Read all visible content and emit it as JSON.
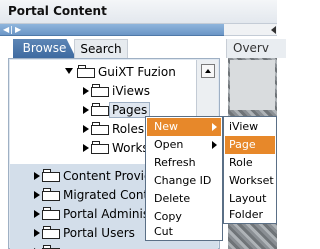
{
  "window": {
    "title": "Portal Content"
  },
  "tabs": [
    {
      "label": "Browse",
      "active": true
    },
    {
      "label": "Search",
      "active": false
    },
    {
      "label": "Overv"
    }
  ],
  "tree": {
    "nodes": [
      {
        "label": "GuiXT Fuzion",
        "expanded": true
      },
      {
        "label": "iViews",
        "expanded": false
      },
      {
        "label": "Pages",
        "expanded": false,
        "selected": true
      },
      {
        "label": "Roles",
        "expanded": false
      },
      {
        "label": "Workset",
        "expanded": false
      },
      {
        "label": "Content Provided",
        "expanded": false
      },
      {
        "label": "Migrated Content",
        "expanded": false
      },
      {
        "label": "Portal Administrat",
        "expanded": false
      },
      {
        "label": "Portal Users",
        "expanded": false
      },
      {
        "label": "",
        "expanded": false
      }
    ]
  },
  "context_menu": {
    "items": [
      "New",
      "Open",
      "Refresh",
      "Change ID",
      "Delete",
      "Copy",
      "Cut"
    ],
    "highlighted": "New"
  },
  "submenu": {
    "items": [
      "iView",
      "Page",
      "Role",
      "Workset",
      "Layout",
      "Folder"
    ],
    "highlighted": "Page"
  },
  "colors": {
    "highlight": "#e7882a",
    "tab_active": "#4a76aa",
    "panel": "#dfe7f0"
  },
  "icons": [
    "folder-icon",
    "expand-arrow-icon",
    "scroll-up-icon",
    "submenu-arrow-icon"
  ]
}
